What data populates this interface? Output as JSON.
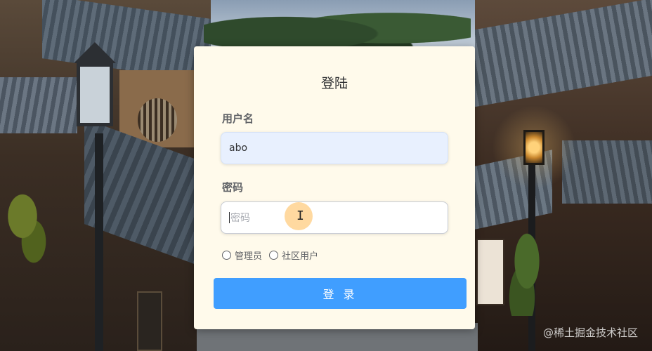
{
  "login_card": {
    "title": "登陆",
    "username_label": "用户名",
    "username_value": "abo",
    "password_label": "密码",
    "password_placeholder": "密码",
    "roles": [
      {
        "label": "管理员",
        "selected": false
      },
      {
        "label": "社区用户",
        "selected": false
      }
    ],
    "login_button": "登 录"
  },
  "watermark": "@稀土掘金技术社区",
  "colors": {
    "card_background": "#fffaeb",
    "primary_button": "#409eff",
    "autofill_input": "#e8f0fe"
  }
}
